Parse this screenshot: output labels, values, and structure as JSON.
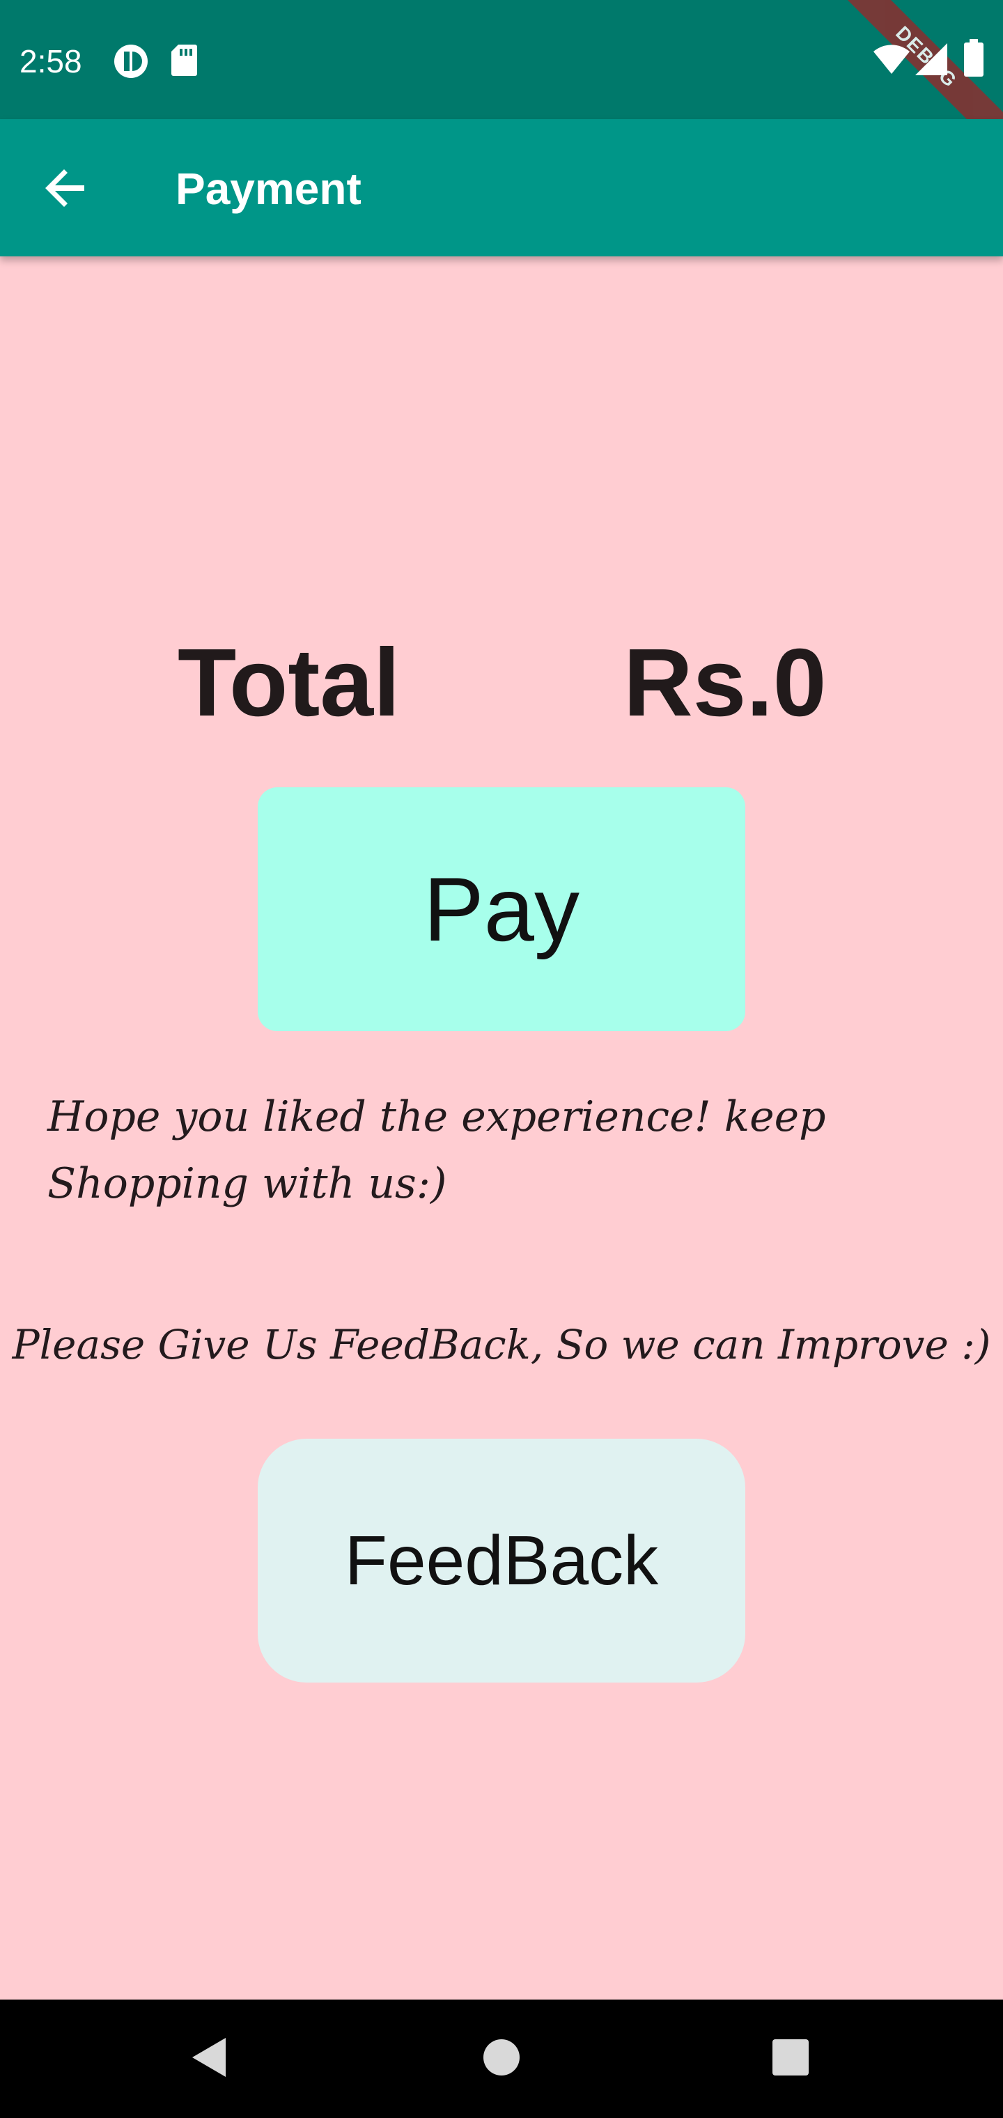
{
  "status_bar": {
    "time": "2:58",
    "icons": [
      "data-saver-icon",
      "sd-card-icon",
      "wifi-icon",
      "signal-icon",
      "battery-icon"
    ],
    "debug_label": "DEBUG",
    "color": "#00796b"
  },
  "app_bar": {
    "title": "Payment",
    "back_icon": "arrow-back-icon",
    "color": "#009688"
  },
  "main": {
    "total_label": "Total",
    "total_value": "Rs.0",
    "pay_button_label": "Pay",
    "message": "Hope you liked the experience! keep Shopping with us:)",
    "feedback_prompt": "Please Give Us FeedBack, So we can Improve :)",
    "feedback_button_label": "FeedBack",
    "background": "#ffcdd2",
    "pay_button_color": "#a7ffeb",
    "feedback_button_color": "#e0f2f1"
  },
  "nav_bar": {
    "buttons": [
      "back-triangle-icon",
      "home-circle-icon",
      "recents-square-icon"
    ]
  }
}
